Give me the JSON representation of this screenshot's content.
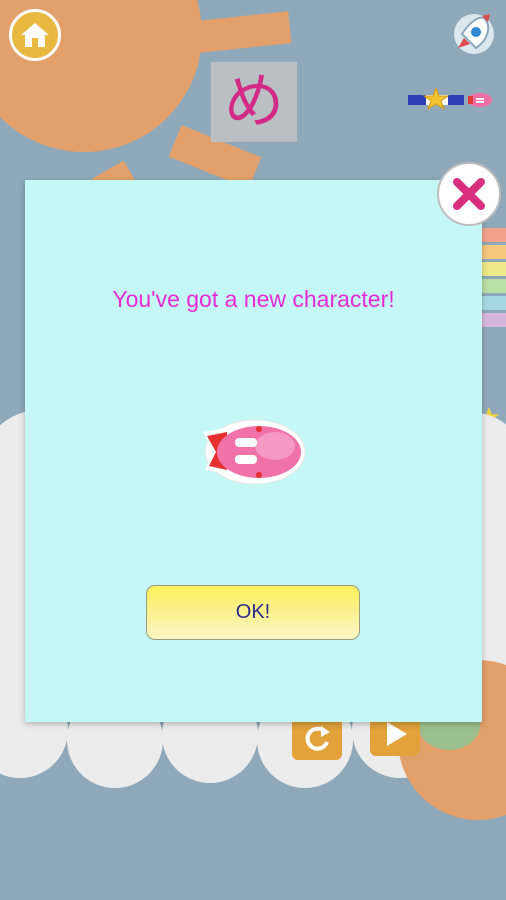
{
  "dialog": {
    "message": "You've got a new character!",
    "ok_label": "OK!"
  },
  "kana_card": {
    "character": "め"
  },
  "icons": {
    "home": "home-icon",
    "rocket": "rocket-icon",
    "close": "close-x-icon",
    "star": "star-icon",
    "new_character": "pink-fish-character",
    "retry": "retry-icon",
    "play": "play-icon"
  },
  "colors": {
    "background": "#8fa9ba",
    "dialog_bg": "#c6f7f7",
    "message_text": "#e62bd6",
    "ok_button": "#fff15c",
    "ok_text": "#2d2a8f",
    "close_x": "#d8307f",
    "kana": "#d22a86",
    "sun": "#e3a06a"
  }
}
